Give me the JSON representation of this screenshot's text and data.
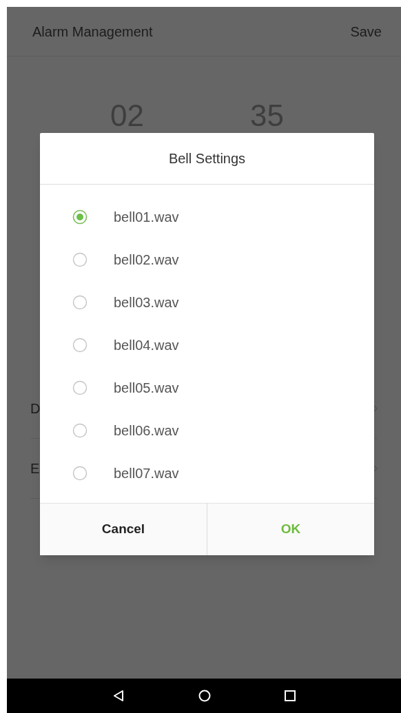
{
  "header": {
    "title": "Alarm Management",
    "action": "Save"
  },
  "time_picker": {
    "column_1": "02",
    "column_2": "35"
  },
  "list_rows": [
    {
      "label": "D"
    },
    {
      "label": "E"
    }
  ],
  "dialog": {
    "title": "Bell Settings",
    "options": [
      {
        "label": "bell01.wav",
        "selected": true
      },
      {
        "label": "bell02.wav",
        "selected": false
      },
      {
        "label": "bell03.wav",
        "selected": false
      },
      {
        "label": "bell04.wav",
        "selected": false
      },
      {
        "label": "bell05.wav",
        "selected": false
      },
      {
        "label": "bell06.wav",
        "selected": false
      },
      {
        "label": "bell07.wav",
        "selected": false
      }
    ],
    "buttons": [
      {
        "label": "Cancel",
        "kind": "cancel"
      },
      {
        "label": "OK",
        "kind": "confirm"
      }
    ]
  }
}
